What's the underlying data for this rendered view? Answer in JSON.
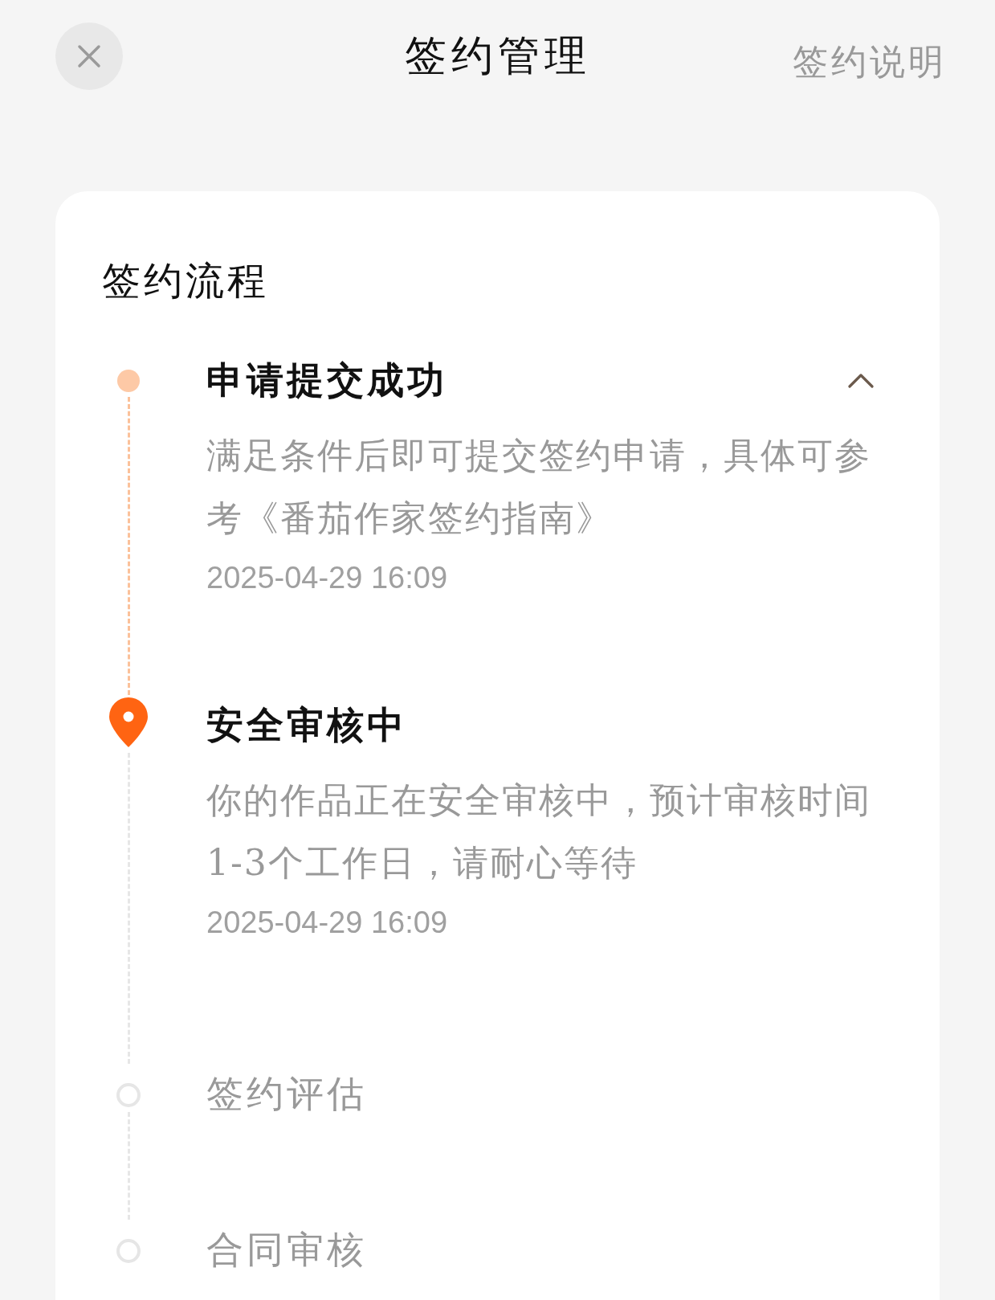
{
  "header": {
    "title": "签约管理",
    "link": "签约说明"
  },
  "card": {
    "heading": "签约流程",
    "steps": [
      {
        "title": "申请提交成功",
        "kind": "done",
        "expanded": true,
        "description": "满足条件后即可提交签约申请，具体可参考《番茄作家签约指南》",
        "time": "2025-04-29 16:09"
      },
      {
        "title": "安全审核中",
        "kind": "current",
        "description": "你的作品正在安全审核中，预计审核时间1-3个工作日，请耐心等待",
        "time": "2025-04-29 16:09"
      },
      {
        "title": "签约评估",
        "kind": "pending"
      },
      {
        "title": "合同审核",
        "kind": "pending"
      }
    ]
  }
}
